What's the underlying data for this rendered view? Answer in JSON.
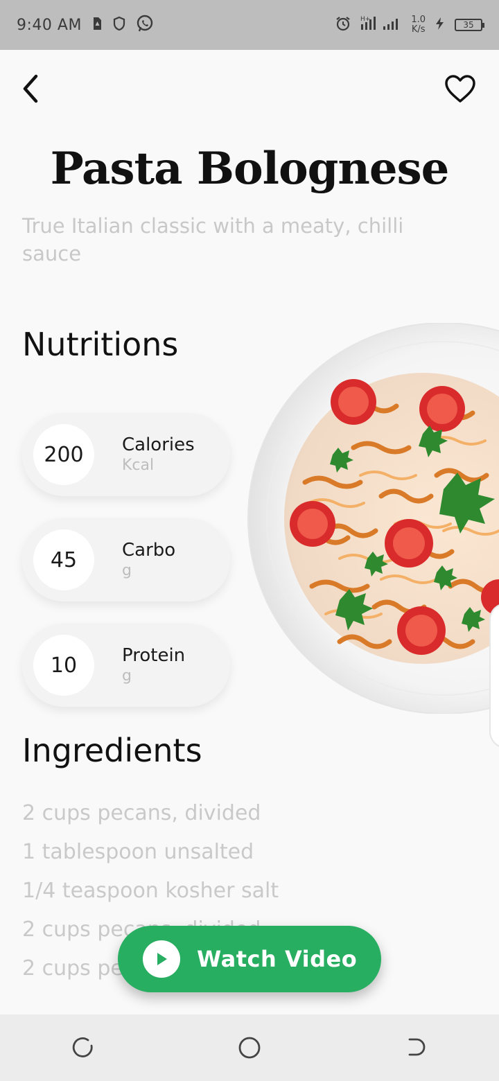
{
  "status_bar": {
    "time": "9:40 AM",
    "net_speed_value": "1.0",
    "net_speed_unit": "K/s",
    "battery": "35",
    "icons": [
      "sim-icon",
      "shield-icon",
      "whatsapp-icon",
      "alarm-icon",
      "signal-icon",
      "charging-icon",
      "battery-icon"
    ]
  },
  "header": {
    "back_icon": "chevron-left-icon",
    "favorite_icon": "heart-icon"
  },
  "recipe": {
    "title": "Pasta Bolognese",
    "subtitle": "True Italian classic with a meaty, chilli sauce"
  },
  "nutrition": {
    "title": "Nutritions",
    "items": [
      {
        "value": "200",
        "name": "Calories",
        "unit": "Kcal"
      },
      {
        "value": "45",
        "name": "Carbo",
        "unit": "g"
      },
      {
        "value": "10",
        "name": "Protein",
        "unit": "g"
      }
    ]
  },
  "ingredients": {
    "title": "Ingredients",
    "items": [
      "2 cups pecans, divided",
      "1 tablespoon unsalted",
      "1/4 teaspoon kosher salt",
      "2 cups pecans, divided",
      "2 cups pecans, divided"
    ]
  },
  "watch_button": {
    "label": "Watch Video",
    "icon": "play-icon",
    "color": "#27ae60"
  },
  "nav_bar": {
    "icons": [
      "recents-icon",
      "home-icon",
      "back-icon"
    ]
  }
}
